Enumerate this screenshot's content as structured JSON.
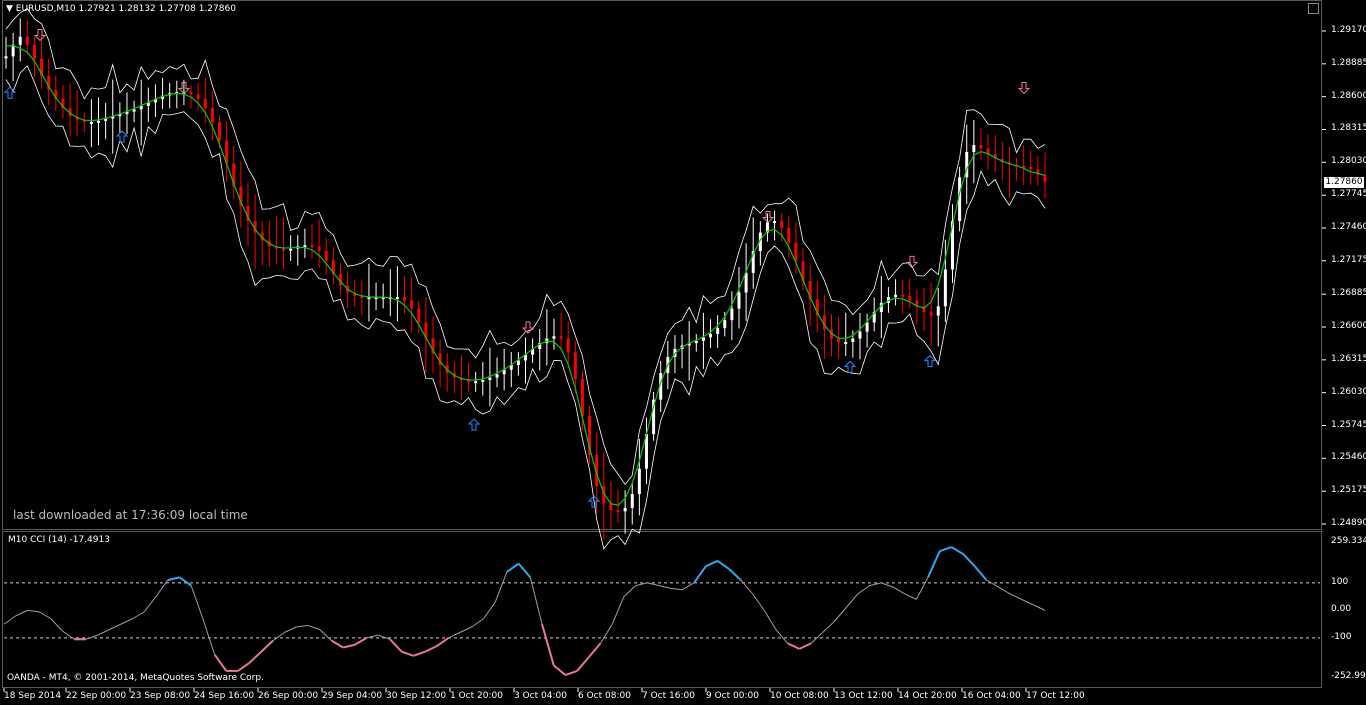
{
  "header": {
    "symbol_line": "▼ EURUSD,M10  1.27921 1.28132 1.27708 1.27860",
    "current_price": "1.27860",
    "indicator_line": "M10 CCI (14) -17.4913"
  },
  "footer": {
    "download_note": "last downloaded at 17:36:09 local time",
    "copyright": "OANDA - MT4, © 2001-2014, MetaQuotes Software Corp."
  },
  "colors": {
    "bull": "#ffffff",
    "bear": "#ff0000",
    "ma": "#00cc00",
    "envelope": "#ffffff",
    "arrow_up": "#1e90ff",
    "arrow_down": "#e08090",
    "cci_high": "#2aaaf0",
    "cci_low": "#e87890",
    "cci_mid": "#a0a0a0"
  },
  "chart_data": [
    {
      "type": "candlestick",
      "symbol": "EURUSD",
      "timeframe": "M10",
      "ylim": [
        1.2489,
        1.2917
      ],
      "y_ticks": [
        "1.29170",
        "1.28885",
        "1.28600",
        "1.28315",
        "1.28030",
        "1.27745",
        "1.27460",
        "1.27175",
        "1.26885",
        "1.26600",
        "1.26315",
        "1.26030",
        "1.25745",
        "1.25460",
        "1.25175",
        "1.24890"
      ],
      "x_ticks": [
        "18 Sep 2014",
        "22 Sep 00:00",
        "23 Sep 08:00",
        "24 Sep 16:00",
        "26 Sep 00:00",
        "29 Sep 04:00",
        "30 Sep 12:00",
        "1 Oct 20:00",
        "3 Oct 04:00",
        "6 Oct 08:00",
        "7 Oct 16:00",
        "9 Oct 00:00",
        "10 Oct 08:00",
        "13 Oct 12:00",
        "14 Oct 20:00",
        "16 Oct 04:00",
        "17 Oct 12:00"
      ],
      "close_path": [
        1.2895,
        1.2905,
        1.2912,
        1.2905,
        1.2893,
        1.2878,
        1.2866,
        1.2858,
        1.285,
        1.2843,
        1.284,
        1.2838,
        1.2838,
        1.2839,
        1.2841,
        1.2843,
        1.2845,
        1.2847,
        1.2849,
        1.2852,
        1.2855,
        1.2858,
        1.2861,
        1.2863,
        1.2864,
        1.2864,
        1.2862,
        1.2858,
        1.285,
        1.2838,
        1.2822,
        1.2802,
        1.2782,
        1.2765,
        1.2752,
        1.2742,
        1.2735,
        1.273,
        1.2728,
        1.2727,
        1.2728,
        1.273,
        1.2731,
        1.273,
        1.2726,
        1.2718,
        1.2706,
        1.2696,
        1.269,
        1.2687,
        1.2686,
        1.2686,
        1.2686,
        1.2686,
        1.2686,
        1.2686,
        1.2683,
        1.2676,
        1.2664,
        1.265,
        1.2637,
        1.2627,
        1.262,
        1.2616,
        1.2614,
        1.2613,
        1.2613,
        1.2614,
        1.2616,
        1.2619,
        1.2623,
        1.2627,
        1.2631,
        1.2636,
        1.2641,
        1.2646,
        1.265,
        1.2652,
        1.265,
        1.2638,
        1.2615,
        1.2583,
        1.2549,
        1.2522,
        1.2507,
        1.2501,
        1.25,
        1.2503,
        1.2515,
        1.2537,
        1.2567,
        1.2597,
        1.262,
        1.2634,
        1.2641,
        1.2644,
        1.2646,
        1.2648,
        1.2651,
        1.2654,
        1.2659,
        1.2666,
        1.2676,
        1.269,
        1.2707,
        1.2726,
        1.2742,
        1.2751,
        1.2752,
        1.2746,
        1.2733,
        1.2717,
        1.27,
        1.2684,
        1.267,
        1.2658,
        1.265,
        1.2647,
        1.2647,
        1.265,
        1.2656,
        1.2664,
        1.2673,
        1.2681,
        1.2686,
        1.2688,
        1.2687,
        1.2683,
        1.2678,
        1.2673,
        1.267,
        1.2678,
        1.271,
        1.2752,
        1.279,
        1.2812,
        1.2818,
        1.2815,
        1.281,
        1.2806,
        1.2803,
        1.2801,
        1.28,
        1.2799,
        1.2797,
        1.2792,
        1.2786
      ],
      "arrows_down": [
        [
          "18 Sep",
          1.2914
        ],
        [
          "23 Sep",
          1.2868
        ],
        [
          "30 Sep",
          1.266
        ],
        [
          "8 Oct",
          1.2756
        ],
        [
          "14 Oct",
          1.2717
        ],
        [
          "16 Oct",
          1.2868
        ]
      ],
      "arrows_up": [
        [
          "18 Sep",
          1.2863
        ],
        [
          "22 Sep",
          1.2825
        ],
        [
          "1 Oct",
          1.2575
        ],
        [
          "3 Oct",
          1.2508
        ],
        [
          "13 Oct",
          1.2625
        ],
        [
          "14 Oct",
          1.263
        ]
      ]
    },
    {
      "type": "line",
      "title": "M10 CCI (14) -17.4913",
      "ylim": [
        -252.9939,
        259.334
      ],
      "y_ticks": [
        "259.334",
        "100",
        "0.00",
        "-100",
        "-252.9939"
      ],
      "levels": [
        100,
        -100
      ],
      "values": [
        -50,
        -20,
        0,
        -5,
        -30,
        -75,
        -105,
        -105,
        -90,
        -70,
        -50,
        -30,
        -5,
        50,
        110,
        120,
        90,
        -30,
        -160,
        -220,
        -220,
        -190,
        -150,
        -110,
        -80,
        -60,
        -55,
        -70,
        -110,
        -135,
        -125,
        -100,
        -90,
        -105,
        -150,
        -165,
        -150,
        -130,
        -100,
        -80,
        -60,
        -30,
        30,
        140,
        170,
        120,
        -50,
        -200,
        -235,
        -220,
        -170,
        -120,
        -50,
        50,
        90,
        100,
        90,
        80,
        75,
        100,
        160,
        180,
        150,
        110,
        60,
        0,
        -70,
        -120,
        -140,
        -120,
        -80,
        -40,
        10,
        60,
        90,
        100,
        85,
        60,
        40,
        120,
        215,
        230,
        205,
        160,
        110,
        85,
        60,
        40,
        20,
        0
      ]
    }
  ]
}
